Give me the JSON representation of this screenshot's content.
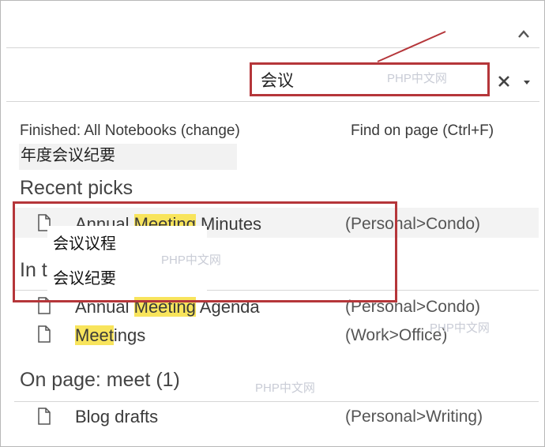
{
  "search": {
    "query": "会议",
    "watermark": "PHP中文网",
    "clear_icon": "close-icon",
    "dropdown_icon": "caret-down-icon"
  },
  "status": {
    "finished_text": "Finished:  All Notebooks (change)",
    "find_on_page": "Find on page (Ctrl+F)",
    "suggestion": "年度会议纪要"
  },
  "recent_picks": {
    "header": "Recent picks",
    "items": [
      {
        "pre": "Annual ",
        "hl": "Meeting",
        "post": " Minutes",
        "location": "(Personal>Condo)"
      }
    ]
  },
  "overlay": {
    "line1": "会议议程",
    "line2": "会议纪要"
  },
  "in_title": {
    "header_fragment": "In t",
    "items": [
      {
        "pre": "Annual ",
        "hl": "Meeting",
        "post": " Agenda",
        "location": "(Personal>Condo)"
      },
      {
        "pre": "",
        "hl": "Meet",
        "post": "ings",
        "location": "(Work>Office)"
      }
    ]
  },
  "on_page": {
    "header": "On page:  meet (1)",
    "items": [
      {
        "title": "Blog drafts",
        "location": "(Personal>Writing)"
      }
    ]
  },
  "watermarks": [
    "PHP中文网",
    "PHP中文网",
    "PHP中文网"
  ],
  "colors": {
    "highlight": "#f8e45c",
    "annotation_red": "#b5363a"
  }
}
